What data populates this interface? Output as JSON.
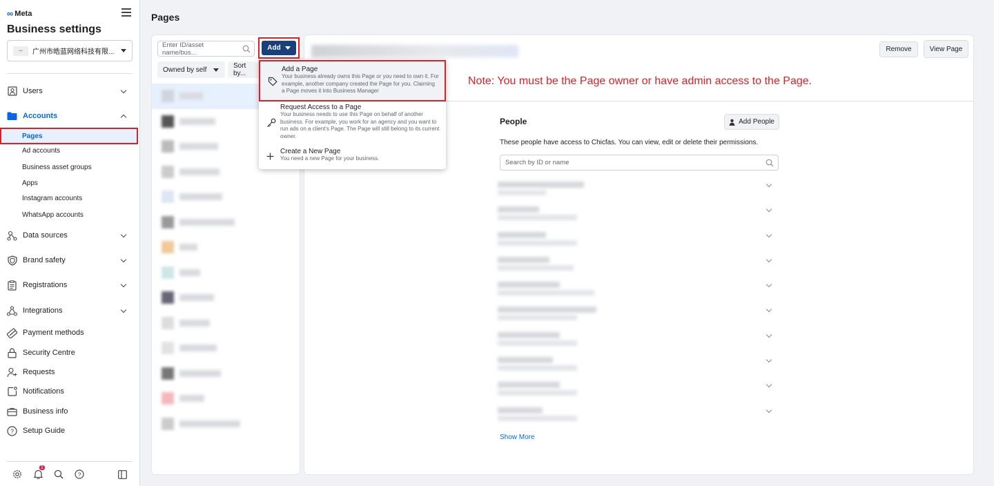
{
  "sidebar": {
    "brand": "Meta",
    "title": "Business settings",
    "business_name": "广州市皓蓝网络科技有限...",
    "nav": [
      {
        "label": "Users",
        "icon": "users-icon"
      },
      {
        "label": "Accounts",
        "icon": "accounts-icon"
      },
      {
        "label": "Data sources",
        "icon": "data-sources-icon"
      },
      {
        "label": "Brand safety",
        "icon": "shield-icon"
      },
      {
        "label": "Registrations",
        "icon": "clipboard-icon"
      },
      {
        "label": "Integrations",
        "icon": "integrations-icon"
      },
      {
        "label": "Payment methods",
        "icon": "card-icon"
      },
      {
        "label": "Security Centre",
        "icon": "lock-icon"
      },
      {
        "label": "Requests",
        "icon": "person-add-icon"
      },
      {
        "label": "Notifications",
        "icon": "notification-icon"
      },
      {
        "label": "Business info",
        "icon": "briefcase-icon"
      },
      {
        "label": "Setup Guide",
        "icon": "help-icon"
      }
    ],
    "accounts_sub": [
      "Pages",
      "Ad accounts",
      "Business asset groups",
      "Apps",
      "Instagram accounts",
      "WhatsApp accounts"
    ],
    "notification_count": "1"
  },
  "main": {
    "page_title": "Pages",
    "search_placeholder": "Enter ID/asset name/bus...",
    "add_label": "Add",
    "owned_filter": "Owned by self",
    "sort_label": "Sort by...",
    "remove_label": "Remove",
    "view_page_label": "View Page",
    "note": "Note: You must be the Page owner or have admin access to the Page.",
    "people": {
      "title": "People",
      "add_people_label": "Add People",
      "description": "These people have access to Chicfas. You can view, edit or delete their permissions.",
      "search_placeholder": "Search by ID or name",
      "show_more": "Show More"
    }
  },
  "dropdown": {
    "items": [
      {
        "title": "Add a Page",
        "desc": "Your business already owns this Page or you need to own it. For example, another company created the Page for you. Claiming a Page moves it into Business Manager",
        "icon": "tag-icon"
      },
      {
        "title": "Request Access to a Page",
        "desc": "Your business needs to use this Page on behalf of another business. For example, you work for an agency and you want to run ads on a client's Page. The Page will still belong to its current owner.",
        "icon": "key-icon"
      },
      {
        "title": "Create a New Page",
        "desc": "You need a new Page for your business.",
        "icon": "plus-icon"
      }
    ]
  }
}
